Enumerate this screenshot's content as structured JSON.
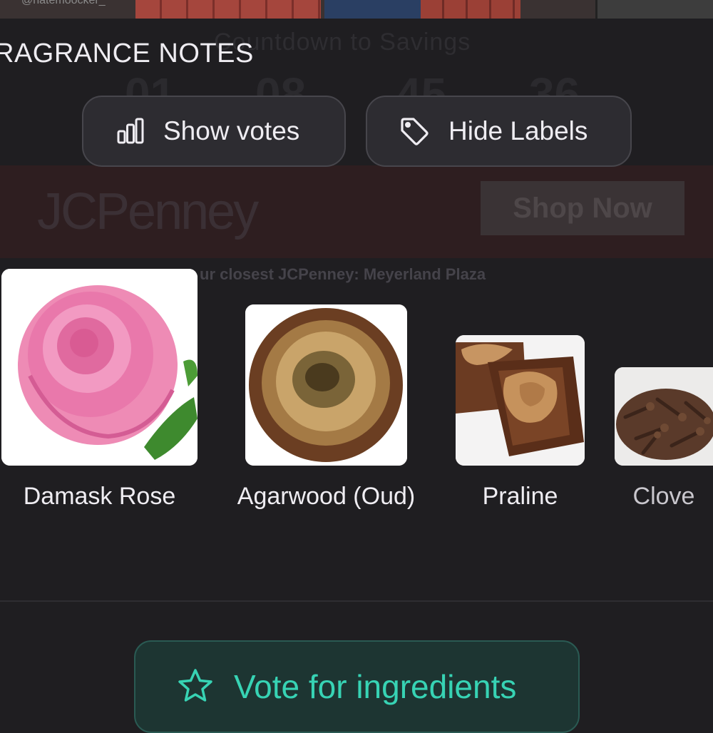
{
  "background": {
    "top_handle": "@hatemoocker_",
    "ad_countdown_title": "Countdown to Savings",
    "ad_digits": [
      "01",
      "08",
      "45",
      "36"
    ],
    "ad_logo": "JCPenney",
    "ad_shop_now": "Shop Now",
    "ad_store": "ur closest JCPenney: Meyerland Plaza"
  },
  "section": {
    "title": "RAGRANCE NOTES"
  },
  "controls": {
    "show_votes": {
      "label": "Show votes",
      "icon": "bar-chart-icon"
    },
    "hide_labels": {
      "label": "Hide Labels",
      "icon": "tag-icon"
    }
  },
  "notes": [
    {
      "label": "Damask Rose",
      "icon": "rose-image"
    },
    {
      "label": "Agarwood (Oud)",
      "icon": "agarwood-image"
    },
    {
      "label": "Praline",
      "icon": "praline-image"
    },
    {
      "label": "Clove",
      "icon": "clove-image"
    }
  ],
  "vote": {
    "label": "Vote for ingredients",
    "icon": "star-outline-icon"
  },
  "colors": {
    "accent": "#37d3b4",
    "bg": "#1f1e21",
    "pill": "#2d2c31"
  }
}
